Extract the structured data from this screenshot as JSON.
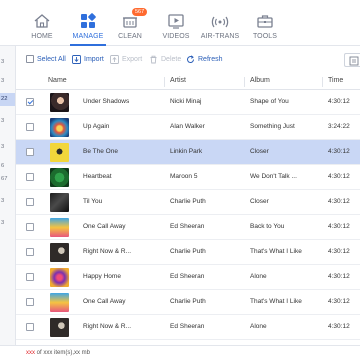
{
  "nav": {
    "items": [
      {
        "label": "HOME",
        "icon": "home-icon"
      },
      {
        "label": "MANAGE",
        "icon": "manage-icon"
      },
      {
        "label": "CLEAN",
        "icon": "clean-icon",
        "badge": "567"
      },
      {
        "label": "VIDEOS",
        "icon": "video-icon"
      },
      {
        "label": "AIR-TRANS",
        "icon": "air-trans-icon"
      },
      {
        "label": "TOOLS",
        "icon": "toolbox-icon"
      }
    ],
    "active": "MANAGE",
    "accent": "#2f6fdc"
  },
  "leftstrip": [
    "3",
    "3",
    "22",
    "3",
    "3",
    "6",
    "67",
    "3",
    "3"
  ],
  "toolbar": {
    "select_all": "Select All",
    "import": "Import",
    "export": "Export",
    "delete": "Delete",
    "refresh": "Refresh"
  },
  "table": {
    "columns": [
      "Name",
      "Artist",
      "Album",
      "Time"
    ],
    "rows": [
      {
        "name": "Under Shadows",
        "artist": "Nicki Minaj",
        "album": "Shape of You",
        "time": "4:30:12",
        "checked": true,
        "highlight": false
      },
      {
        "name": "Up Again",
        "artist": "Alan Walker",
        "album": "Something Just",
        "time": "3:24:22",
        "checked": false,
        "highlight": false
      },
      {
        "name": "Be The One",
        "artist": "Linkin Park",
        "album": "Closer",
        "time": "4:30:12",
        "checked": false,
        "highlight": true
      },
      {
        "name": "Heartbeat",
        "artist": "Maroon 5",
        "album": "We Don't Talk ...",
        "time": "4:30:12",
        "checked": false,
        "highlight": false
      },
      {
        "name": "Til You",
        "artist": "Charlie Puth",
        "album": "Closer",
        "time": "4:30:12",
        "checked": false,
        "highlight": false
      },
      {
        "name": "One Call Away",
        "artist": "Ed Sheeran",
        "album": "Back to You",
        "time": "4:30:12",
        "checked": false,
        "highlight": false
      },
      {
        "name": "Right Now & R...",
        "artist": "Charlie Puth",
        "album": "That's What I Like",
        "time": "4:30:12",
        "checked": false,
        "highlight": false
      },
      {
        "name": "Happy Home",
        "artist": "Ed Sheeran",
        "album": "Alone",
        "time": "4:30:12",
        "checked": false,
        "highlight": false
      },
      {
        "name": "One Call Away",
        "artist": "Charlie Puth",
        "album": "That's What I Like",
        "time": "4:30:12",
        "checked": false,
        "highlight": false
      },
      {
        "name": "Right Now & R...",
        "artist": "Ed Sheeran",
        "album": "Alone",
        "time": "4:30:12",
        "checked": false,
        "highlight": false
      }
    ]
  },
  "footer": {
    "count_red": "xxx",
    "rest": " of xxx item(s),xx mb"
  }
}
